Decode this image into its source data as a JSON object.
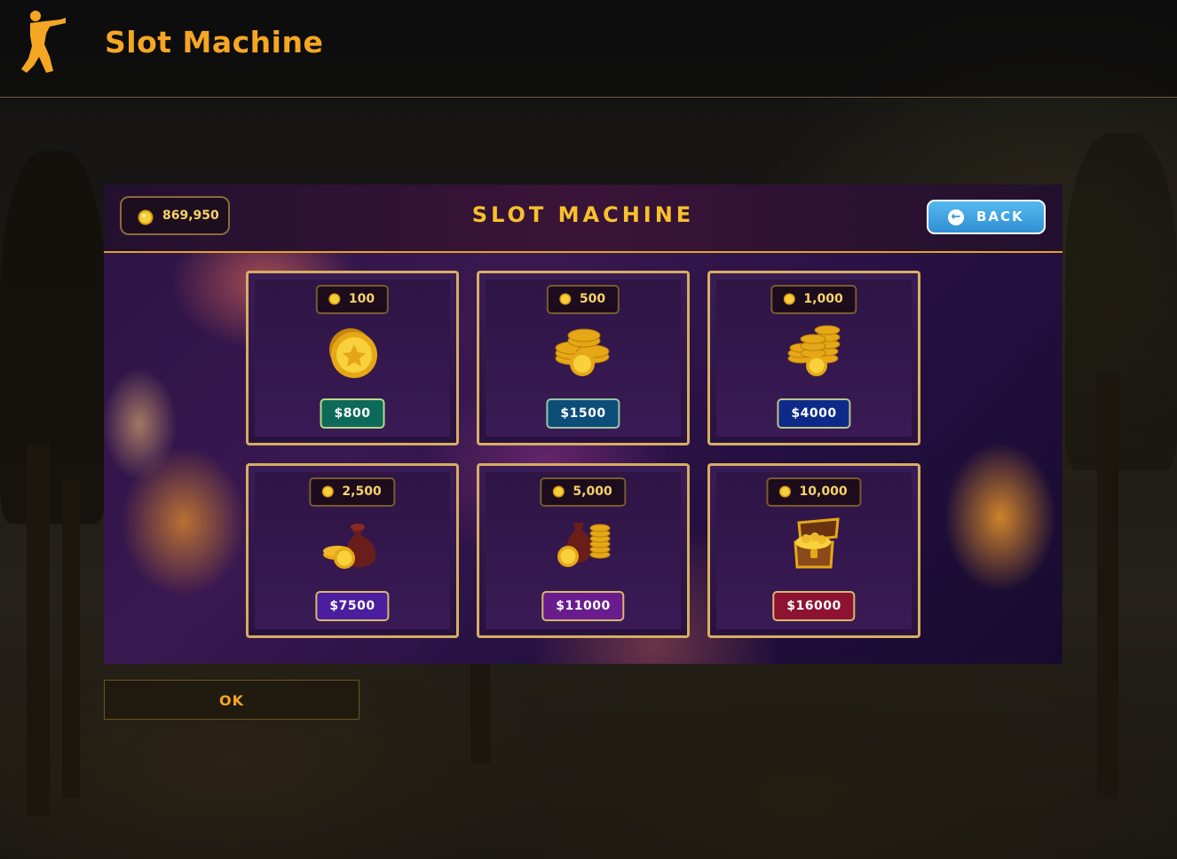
{
  "app": {
    "title": "Slot Machine"
  },
  "panel": {
    "title": "SLOT MACHINE",
    "balance": "869,950",
    "back_label": "BACK"
  },
  "packages": [
    {
      "amount": "100",
      "price": "$800",
      "icon": "single-coin-icon"
    },
    {
      "amount": "500",
      "price": "$1500",
      "icon": "coin-stack-icon"
    },
    {
      "amount": "1,000",
      "price": "$4000",
      "icon": "coin-pile-icon"
    },
    {
      "amount": "2,500",
      "price": "$7500",
      "icon": "coin-bag-icon"
    },
    {
      "amount": "5,000",
      "price": "$11000",
      "icon": "coin-bag-stack-icon"
    },
    {
      "amount": "10,000",
      "price": "$16000",
      "icon": "treasure-chest-icon"
    }
  ],
  "footer": {
    "ok_label": "OK"
  },
  "colors": {
    "accent": "#f5a623",
    "title_gold": "#f7c12b",
    "back_button": "#3a9fe0",
    "card_border": "#d7ae62"
  }
}
